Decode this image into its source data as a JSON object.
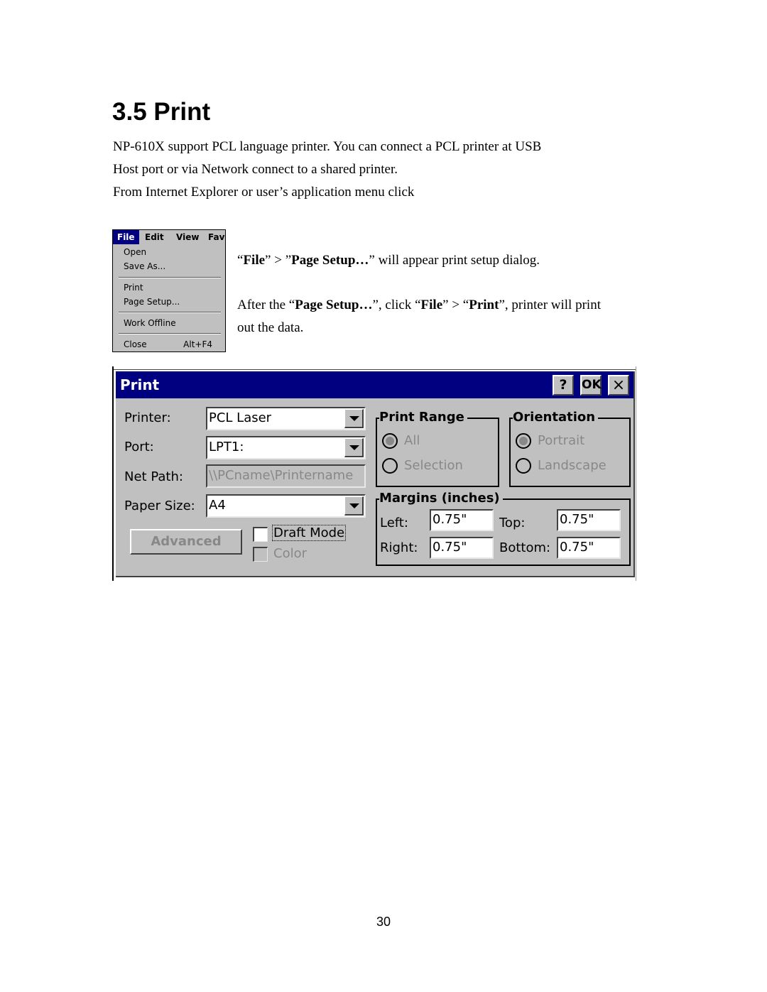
{
  "heading": "3.5 Print",
  "intro": {
    "line1": "NP-610X support PCL language printer. You can connect a PCL printer at USB",
    "line2": "Host port or via Network connect to a shared printer.",
    "line3": "From Internet Explorer or user’s application menu click"
  },
  "instructions": {
    "p1": {
      "q1": "“",
      "b1": "File",
      "t1": "” > ”",
      "b2": "Page Setup…",
      "t2": "” will appear print setup dialog."
    },
    "p2": {
      "t0": "After the “",
      "b1": "Page Setup…",
      "t1": "”, click “",
      "b2": "File",
      "t2": "” > “",
      "b3": "Print",
      "t3": "”, printer will print"
    },
    "p2_line2": "out the data."
  },
  "file_menu": {
    "menubar": [
      "File",
      "Edit",
      "View",
      "Fav"
    ],
    "items": [
      {
        "label": "Open"
      },
      {
        "label": "Save As..."
      },
      {
        "label": "Print"
      },
      {
        "label": "Page Setup..."
      },
      {
        "label": "Work Offline"
      },
      {
        "label": "Close",
        "shortcut": "Alt+F4"
      }
    ]
  },
  "print_dialog": {
    "title": "Print",
    "title_buttons": {
      "help": "?",
      "ok": "OK",
      "close": "×"
    },
    "printer": {
      "label": "Printer:",
      "value": "PCL Laser"
    },
    "port": {
      "label": "Port:",
      "value": "LPT1:"
    },
    "net_path": {
      "label": "Net Path:",
      "value": "\\\\PCname\\Printername"
    },
    "paper_size": {
      "label": "Paper Size:",
      "value": "A4"
    },
    "advanced_button": "Advanced",
    "draft_mode": {
      "label": "Draft Mode",
      "checked": false
    },
    "color": {
      "label": "Color",
      "checked": false,
      "disabled": true
    },
    "print_range": {
      "label": "Print Range",
      "options": [
        "All",
        "Selection"
      ],
      "selected": "All"
    },
    "orientation": {
      "label": "Orientation",
      "options": [
        "Portrait",
        "Landscape"
      ],
      "selected": "Portrait"
    },
    "margins": {
      "label": "Margins (inches)",
      "left": {
        "label": "Left:",
        "value": "0.75\""
      },
      "top": {
        "label": "Top:",
        "value": "0.75\""
      },
      "right": {
        "label": "Right:",
        "value": "0.75\""
      },
      "bottom": {
        "label": "Bottom:",
        "value": "0.75\""
      }
    }
  },
  "page_number": "30"
}
